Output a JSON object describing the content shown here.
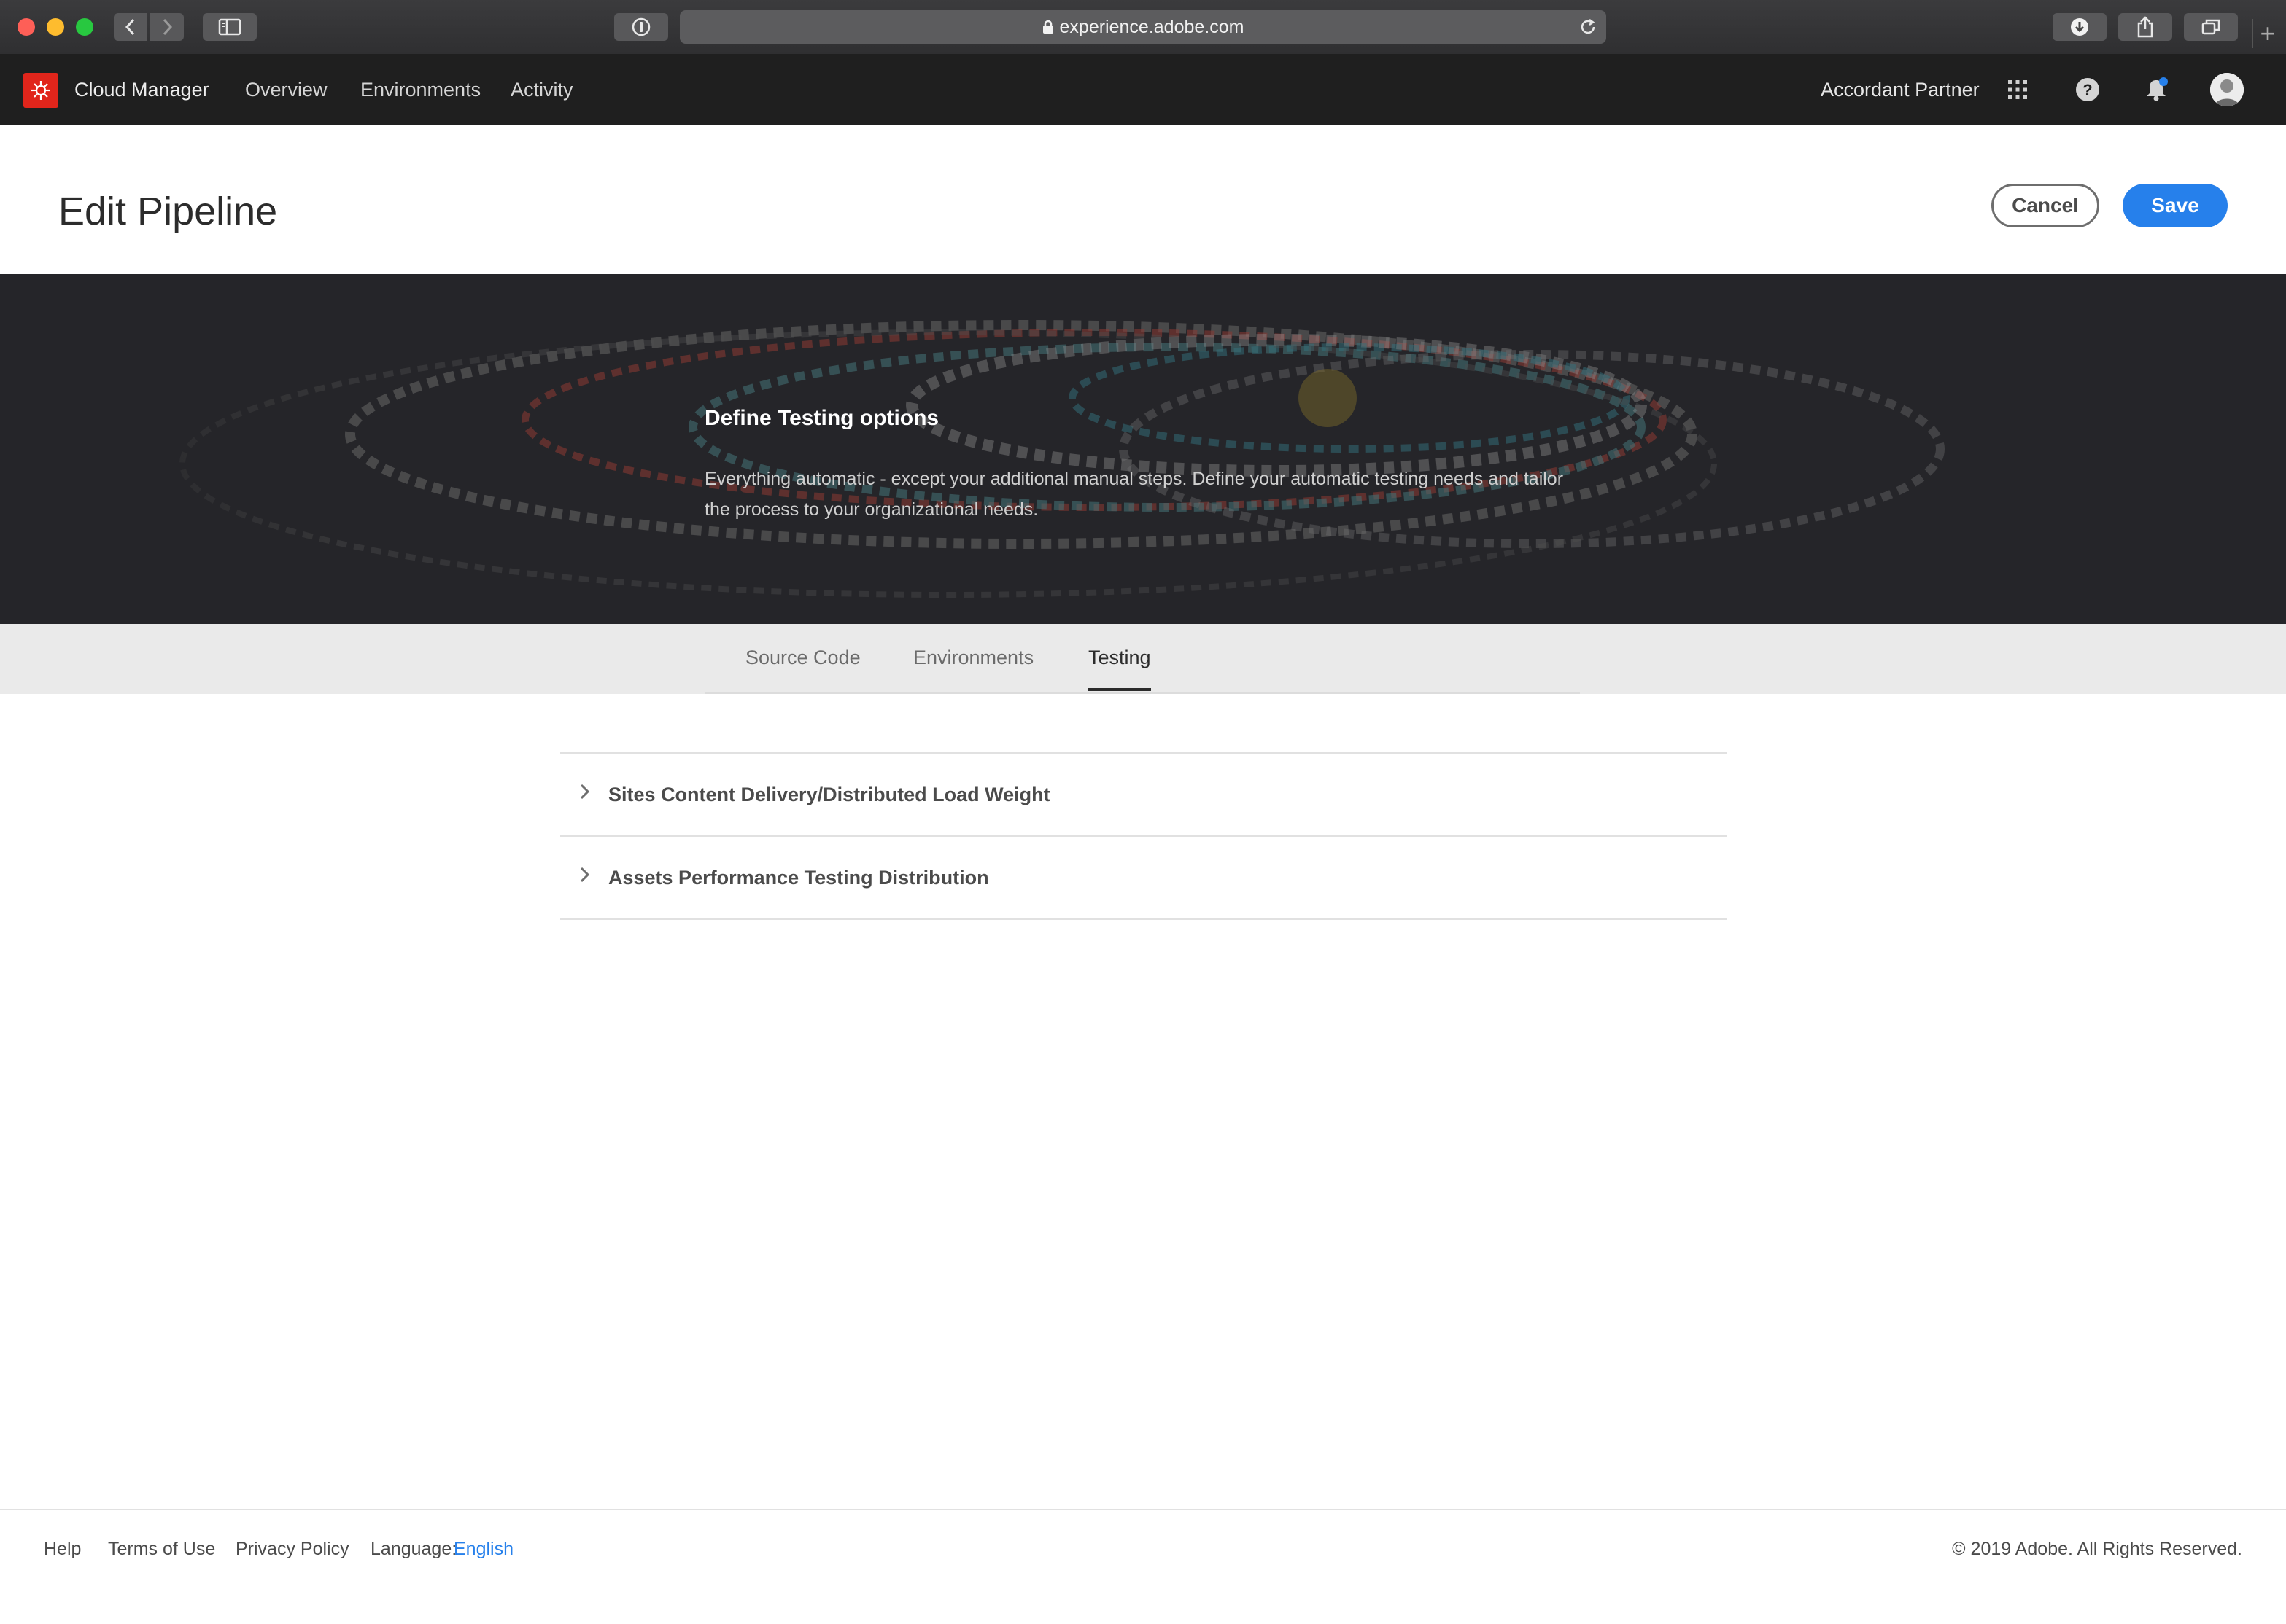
{
  "browser": {
    "url": "experience.adobe.com"
  },
  "app_header": {
    "app_name": "Cloud Manager",
    "nav": [
      {
        "label": "Overview"
      },
      {
        "label": "Environments"
      },
      {
        "label": "Activity"
      }
    ],
    "org_name": "Accordant Partner",
    "notification_dot_color": "#2680eb",
    "brand_color": "#e1251b"
  },
  "page": {
    "title": "Edit Pipeline",
    "cancel_label": "Cancel",
    "save_label": "Save",
    "accent_color": "#2680eb"
  },
  "hero": {
    "title": "Define Testing options",
    "text": "Everything automatic - except your additional manual steps. Define your automatic testing needs and tailor the process to your organizational needs."
  },
  "tabs": [
    {
      "label": "Source Code",
      "active": false
    },
    {
      "label": "Environments",
      "active": false
    },
    {
      "label": "Testing",
      "active": true
    }
  ],
  "sections": [
    {
      "label": "Sites Content Delivery/Distributed Load Weight",
      "expanded": false
    },
    {
      "label": "Assets Performance Testing Distribution",
      "expanded": false
    }
  ],
  "footer": {
    "links": [
      {
        "label": "Help"
      },
      {
        "label": "Terms of Use"
      },
      {
        "label": "Privacy Policy"
      }
    ],
    "language_prefix": "Language:",
    "language_value": "English",
    "copyright": "© 2019 Adobe. All Rights Reserved."
  }
}
